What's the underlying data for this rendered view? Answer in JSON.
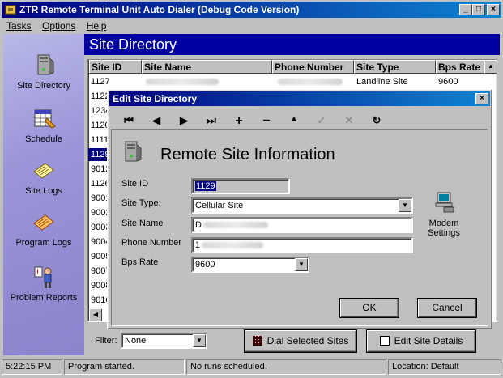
{
  "window": {
    "title": "ZTR Remote Terminal Unit Auto Dialer (Debug Code Version)",
    "min": "_",
    "max": "□",
    "close": "×"
  },
  "menu": {
    "tasks": "Tasks",
    "options": "Options",
    "help": "Help"
  },
  "sidebar": {
    "items": [
      {
        "label": "Site Directory"
      },
      {
        "label": "Schedule"
      },
      {
        "label": "Site Logs"
      },
      {
        "label": "Program Logs"
      },
      {
        "label": "Problem Reports"
      }
    ]
  },
  "panel": {
    "title": "Site Directory"
  },
  "table": {
    "headers": {
      "site_id": "Site ID",
      "site_name": "Site Name",
      "phone": "Phone Number",
      "site_type": "Site Type",
      "bps": "Bps Rate"
    },
    "first_row": {
      "site_id": "1127",
      "site_type": "Landline Site",
      "bps": "9600"
    },
    "ids": [
      "1127",
      "1122",
      "1234",
      "1120",
      "1111",
      "1129",
      "9012",
      "1126",
      "9001",
      "9002",
      "9003",
      "9004",
      "9005",
      "9007",
      "9008",
      "9016"
    ],
    "visible_ids": [
      "1127",
      "1122",
      "1234",
      "1120",
      "1111",
      "1129",
      "9012",
      "1126",
      "9001",
      "9002",
      "9003",
      "9004",
      "9005",
      "9007",
      "9008",
      "9016"
    ]
  },
  "filter": {
    "label": "Filter:",
    "value": "None"
  },
  "buttons": {
    "dial": "Dial  Selected Sites",
    "edit": "Edit Site Details"
  },
  "dialog": {
    "title": "Edit Site Directory",
    "heading": "Remote Site Information",
    "labels": {
      "site_id": "Site ID",
      "site_type": "Site Type:",
      "site_name": "Site Name",
      "phone": "Phone Number",
      "bps": "Bps Rate"
    },
    "values": {
      "site_id": "1129",
      "site_type": "Cellular Site",
      "site_name": "D",
      "phone": "1",
      "bps": "9600"
    },
    "modem_label_1": "Modem",
    "modem_label_2": "Settings",
    "ok": "OK",
    "cancel": "Cancel"
  },
  "status": {
    "time": "5:22:15 PM",
    "msg1": "Program started.",
    "msg2": "No runs scheduled.",
    "location": "Location: Default"
  },
  "colors": {
    "title_bar": "#000080",
    "panel_header": "#0000a0",
    "selection": "#000080",
    "sidebar": "#9a94d8"
  }
}
